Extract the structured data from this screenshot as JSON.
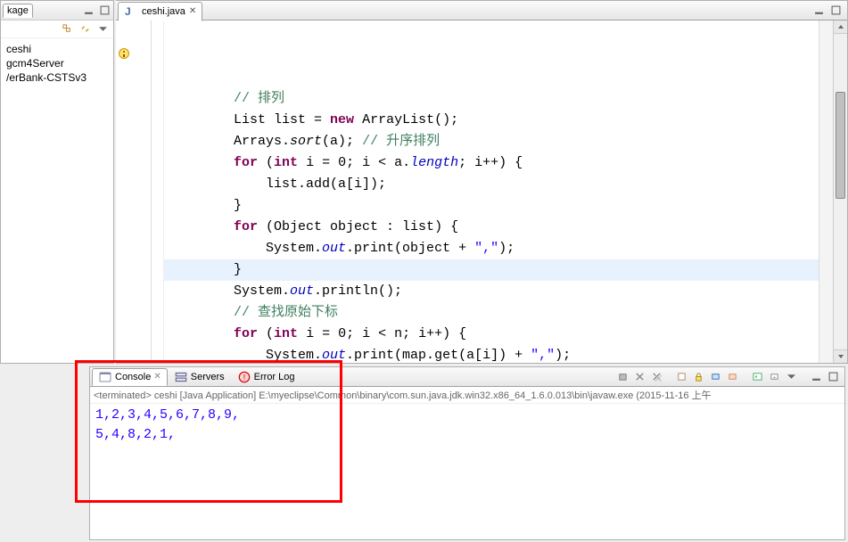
{
  "sidebar": {
    "title": "kage",
    "items": [
      "ceshi",
      "gcm4Server",
      "/erBank-CSTSv3"
    ]
  },
  "editor": {
    "tab_label": "ceshi.java",
    "code_tokens": [
      [
        [
          " ",
          "        "
        ],
        [
          "c-com",
          "// 排列"
        ]
      ],
      [
        [
          " ",
          "        "
        ],
        [
          "",
          "List list = "
        ],
        [
          "c-key",
          "new"
        ],
        [
          "",
          " ArrayList();"
        ]
      ],
      [
        [
          " ",
          "        "
        ],
        [
          "",
          "Arrays."
        ],
        [
          "c-method-i",
          "sort"
        ],
        [
          "",
          "(a); "
        ],
        [
          "c-com",
          "// 升序排列"
        ]
      ],
      [
        [
          " ",
          "        "
        ],
        [
          "c-key",
          "for"
        ],
        [
          "",
          " ("
        ],
        [
          "c-key",
          "int"
        ],
        [
          "",
          " i = 0; i < a."
        ],
        [
          "c-static",
          "length"
        ],
        [
          "",
          "; i++) {"
        ]
      ],
      [
        [
          " ",
          "            list.add(a[i]);"
        ]
      ],
      [
        [
          " ",
          "        }"
        ]
      ],
      [
        [
          " ",
          "        "
        ],
        [
          "c-key",
          "for"
        ],
        [
          "",
          " (Object object : list) {"
        ]
      ],
      [
        [
          " ",
          "            System."
        ],
        [
          "c-static",
          "out"
        ],
        [
          "",
          ".print(object + "
        ],
        [
          "c-str",
          "\",\""
        ],
        [
          "",
          ");"
        ]
      ],
      [
        [
          " ",
          "        }"
        ]
      ],
      [
        [
          " ",
          "        System."
        ],
        [
          "c-static",
          "out"
        ],
        [
          "",
          ".println();"
        ]
      ],
      [
        [
          " ",
          ""
        ]
      ],
      [
        [
          " ",
          "        "
        ],
        [
          "c-com",
          "// 查找原始下标"
        ]
      ],
      [
        [
          " ",
          "        "
        ],
        [
          "c-key",
          "for"
        ],
        [
          "",
          " ("
        ],
        [
          "c-key",
          "int"
        ],
        [
          "",
          " i = 0; i < n; i++) {"
        ]
      ],
      [
        [
          " ",
          "            System."
        ],
        [
          "c-static",
          "out"
        ],
        [
          "",
          ".print(map.get(a[i]) + "
        ],
        [
          "c-str",
          "\",\""
        ],
        [
          "",
          ");"
        ]
      ],
      [
        [
          " ",
          "        }"
        ]
      ]
    ]
  },
  "bottom": {
    "tabs": {
      "console": "Console",
      "servers": "Servers",
      "errorlog": "Error Log"
    },
    "status": "<terminated> ceshi [Java Application] E:\\myeclipse\\Common\\binary\\com.sun.java.jdk.win32.x86_64_1.6.0.013\\bin\\javaw.exe (2015-11-16 上午",
    "output_lines": [
      "1,2,3,4,5,6,7,8,9,",
      "5,4,8,2,1,"
    ]
  }
}
